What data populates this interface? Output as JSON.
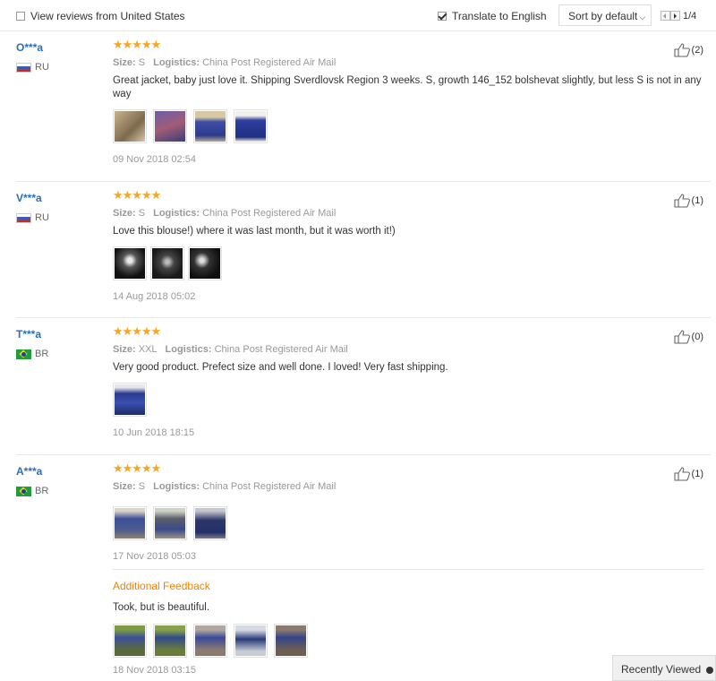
{
  "toolbar": {
    "filter_label": "View reviews from United States",
    "translate_label": "Translate to English",
    "sort_label": "Sort by default",
    "page_text": "1/4"
  },
  "reviews": [
    {
      "user": "O***a",
      "country": "RU",
      "size_label": "Size:",
      "size": "S",
      "logistics_label": "Logistics:",
      "logistics": "China Post Registered Air Mail",
      "text": "Great jacket, baby just love it. Shipping Sverdlovsk Region 3 weeks. S, growth 146_152 bolshevat slightly, but less S is not in any way",
      "date": "09 Nov 2018 02:54",
      "likes": "(2)",
      "photos": 4
    },
    {
      "user": "V***a",
      "country": "RU",
      "size_label": "Size:",
      "size": "S",
      "logistics_label": "Logistics:",
      "logistics": "China Post Registered Air Mail",
      "text": "Love this blouse!) where it was last month, but it was worth it!)",
      "date": "14 Aug 2018 05:02",
      "likes": "(1)",
      "photos": 3
    },
    {
      "user": "T***a",
      "country": "BR",
      "size_label": "Size:",
      "size": "XXL",
      "logistics_label": "Logistics:",
      "logistics": "China Post Registered Air Mail",
      "text": "Very good product. Prefect size and well done. I loved! Very fast shipping.",
      "date": "10 Jun 2018 18:15",
      "likes": "(0)",
      "photos": 1
    },
    {
      "user": "A***a",
      "country": "BR",
      "size_label": "Size:",
      "size": "S",
      "logistics_label": "Logistics:",
      "logistics": "China Post Registered Air Mail",
      "text": "",
      "date": "17 Nov 2018 05:03",
      "likes": "(1)",
      "photos": 3,
      "additional": {
        "title": "Additional Feedback",
        "text": "Took, but is beautiful.",
        "date": "18 Nov 2018 03:15",
        "photos": 5
      }
    }
  ],
  "recently_viewed": "Recently Viewed",
  "colors": {
    "accent": "#2a6ebb",
    "star": "#f5a623",
    "feedback": "#f08200"
  }
}
